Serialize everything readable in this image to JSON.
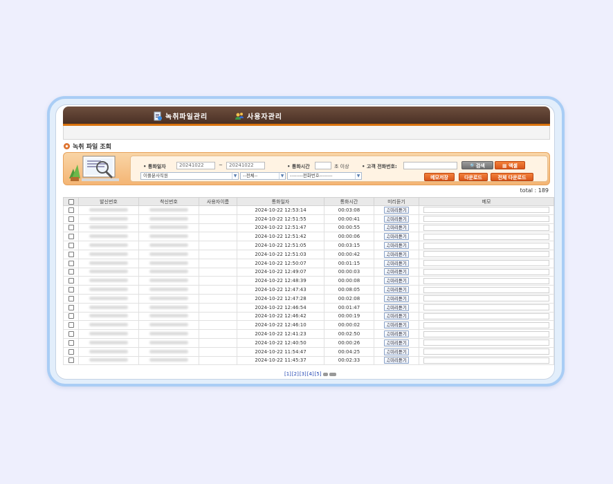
{
  "menu": {
    "items": [
      {
        "label": "녹취파일관리",
        "icon": "document-icon"
      },
      {
        "label": "사용자관리",
        "icon": "users-icon"
      }
    ]
  },
  "page_title": "녹취 파일 조회",
  "search": {
    "date_label": "• 통화일자",
    "date_from": "20241022",
    "date_sep": "~",
    "date_to": "20241022",
    "duration_label": "• 통화시간",
    "duration_value": "",
    "duration_suffix": "초 이상",
    "phone_label": "• 고객 전화번호:",
    "phone_value": "",
    "branch_select": "이플분사직원",
    "all_select": "--전체--",
    "phone_select": "--------전화번호--------",
    "search_button": "검색",
    "excel_button": "엑셀",
    "memo_save_button": "메모저장",
    "download_button": "다운로드",
    "download_all_button": "전체 다운로드"
  },
  "total_text": "total : 189",
  "table": {
    "columns": [
      "발신번호",
      "착신번호",
      "사용자이름",
      "통화일자",
      "통화시간",
      "미리듣기",
      "메모"
    ],
    "preview_label": "미리듣기",
    "rows": [
      {
        "date": "2024-10-22 12:53:14",
        "duration": "00:03:08"
      },
      {
        "date": "2024-10-22 12:51:55",
        "duration": "00:00:41"
      },
      {
        "date": "2024-10-22 12:51:47",
        "duration": "00:00:55"
      },
      {
        "date": "2024-10-22 12:51:42",
        "duration": "00:00:06"
      },
      {
        "date": "2024-10-22 12:51:05",
        "duration": "00:03:15"
      },
      {
        "date": "2024-10-22 12:51:03",
        "duration": "00:00:42"
      },
      {
        "date": "2024-10-22 12:50:07",
        "duration": "00:01:15"
      },
      {
        "date": "2024-10-22 12:49:07",
        "duration": "00:00:03"
      },
      {
        "date": "2024-10-22 12:48:39",
        "duration": "00:00:08"
      },
      {
        "date": "2024-10-22 12:47:43",
        "duration": "00:08:05"
      },
      {
        "date": "2024-10-22 12:47:28",
        "duration": "00:02:08"
      },
      {
        "date": "2024-10-22 12:46:54",
        "duration": "00:01:47"
      },
      {
        "date": "2024-10-22 12:46:42",
        "duration": "00:00:19"
      },
      {
        "date": "2024-10-22 12:46:10",
        "duration": "00:00:02"
      },
      {
        "date": "2024-10-22 12:41:23",
        "duration": "00:02:50"
      },
      {
        "date": "2024-10-22 12:40:50",
        "duration": "00:00:26"
      },
      {
        "date": "2024-10-22 11:54:47",
        "duration": "00:04:25"
      },
      {
        "date": "2024-10-22 11:45:37",
        "duration": "00:02:33"
      }
    ]
  },
  "pagination": {
    "pages": [
      "[1]",
      "[2]",
      "[3]",
      "[4]",
      "[5]"
    ]
  },
  "colors": {
    "header_brown": "#5a3d2e",
    "accent_orange": "#e06a22",
    "frame_blue": "#a9cdf5",
    "link_blue": "#1a3fb0"
  }
}
